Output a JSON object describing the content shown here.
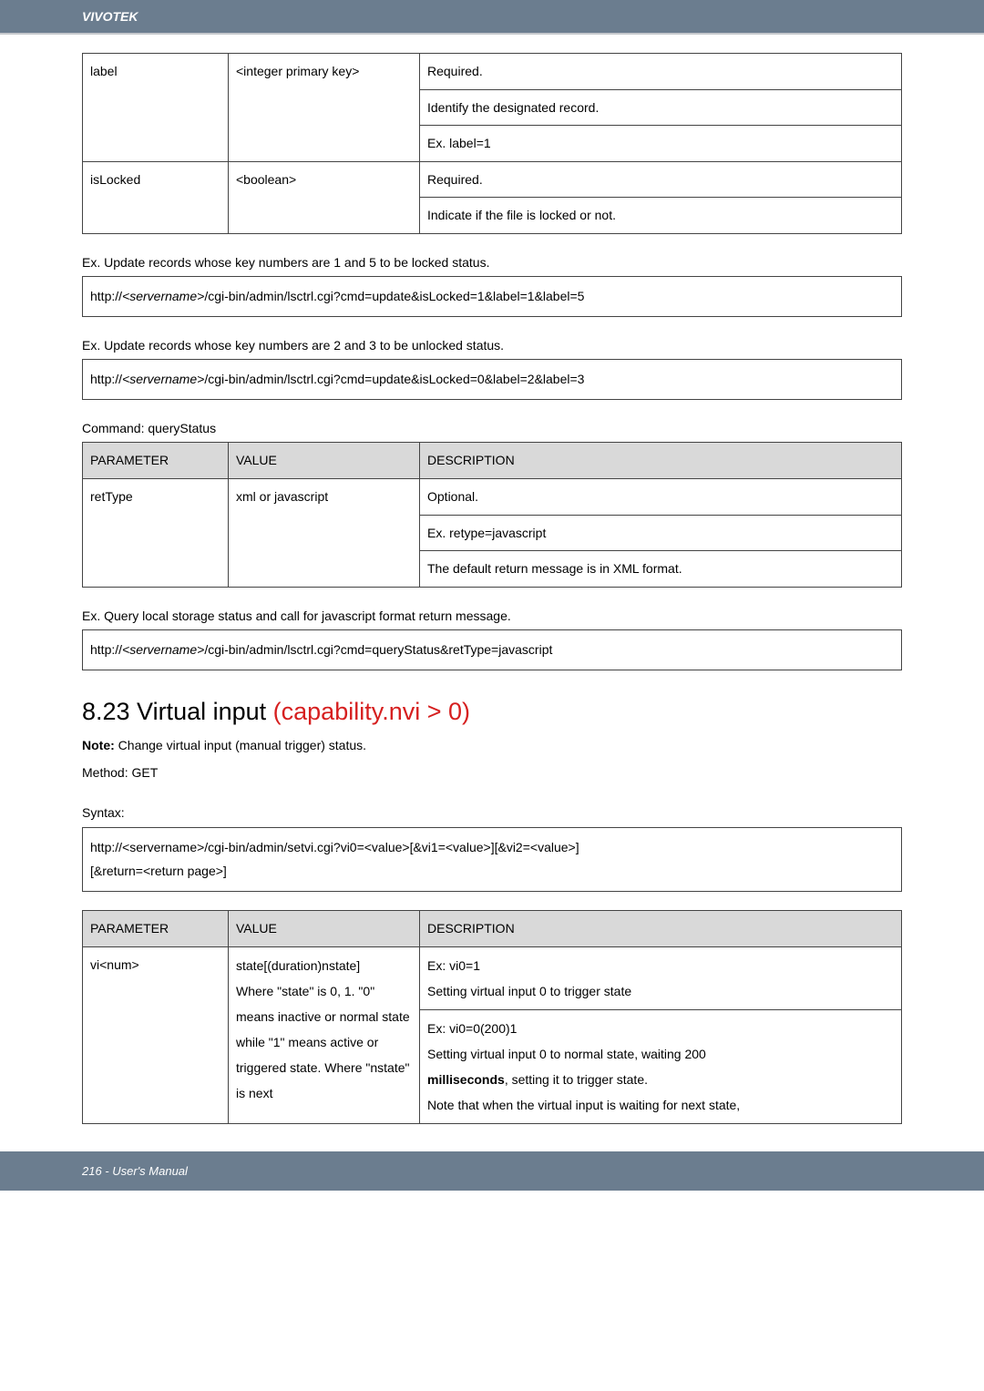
{
  "brand": "VIVOTEK",
  "table1": {
    "r1": {
      "param": "label",
      "value": "<integer primary key>",
      "desc1": "Required.",
      "desc2": "Identify the designated record.",
      "desc3": "Ex. label=1"
    },
    "r2": {
      "param": "isLocked",
      "value": "<boolean>",
      "desc1": "Required.",
      "desc2": "Indicate if the file is locked or not."
    }
  },
  "ex1": {
    "caption": "Ex. Update records whose key numbers are 1 and 5 to be locked status.",
    "url_prefix": "http://",
    "server": "<servername>",
    "url_suffix": "/cgi-bin/admin/lsctrl.cgi?cmd=update&isLocked=1&label=1&label=5"
  },
  "ex2": {
    "caption": "Ex. Update records whose key numbers are 2 and 3 to be unlocked status.",
    "url_prefix": "http://",
    "server": "<servername>",
    "url_suffix": "/cgi-bin/admin/lsctrl.cgi?cmd=update&isLocked=0&label=2&label=3"
  },
  "cmd_label": "Command: queryStatus",
  "table2": {
    "h1": "PARAMETER",
    "h2": "VALUE",
    "h3": "DESCRIPTION",
    "r1": {
      "param": "retType",
      "value": "xml or javascript",
      "desc1": "Optional.",
      "desc2": "Ex. retype=javascript",
      "desc3": "The default return message is in XML format."
    }
  },
  "ex3": {
    "caption": "Ex. Query local storage status and call for javascript format return message.",
    "url_prefix": "http://",
    "server": "<servername>",
    "url_suffix": "/cgi-bin/admin/lsctrl.cgi?cmd=queryStatus&retType=javascript"
  },
  "heading": {
    "num": "8.23 Virtual input ",
    "red": "(capability.nvi > 0)"
  },
  "note_bold": "Note:",
  "note_rest": " Change virtual input (manual trigger) status.",
  "method": "Method: GET",
  "syntax_label": "Syntax:",
  "syntax_box": {
    "line1": "http://<servername>/cgi-bin/admin/setvi.cgi?vi0=<value>[&vi1=<value>][&vi2=<value>]",
    "line2": "[&return=<return page>]"
  },
  "table3": {
    "h1": "PARAMETER",
    "h2": "VALUE",
    "h3": "DESCRIPTION",
    "r1": {
      "param": "vi<num>",
      "val_lines": {
        "l1": "state[(duration)nstate]",
        "l2": "",
        "l3": "Where \"state\" is 0, 1. \"0\" means inactive or normal state while \"1\" means active or triggered state. Where \"nstate\" is next"
      },
      "desc": {
        "d1": "Ex: vi0=1",
        "d2": "Setting virtual input 0 to trigger state",
        "d3": "Ex: vi0=0(200)1",
        "d4": "Setting virtual input 0 to normal state, waiting 200 ",
        "d5_bold": "milliseconds",
        "d5_rest": ", setting it to trigger state.",
        "d6": "Note that when the virtual input is waiting for next state,"
      }
    }
  },
  "footer": "216 - User's Manual"
}
